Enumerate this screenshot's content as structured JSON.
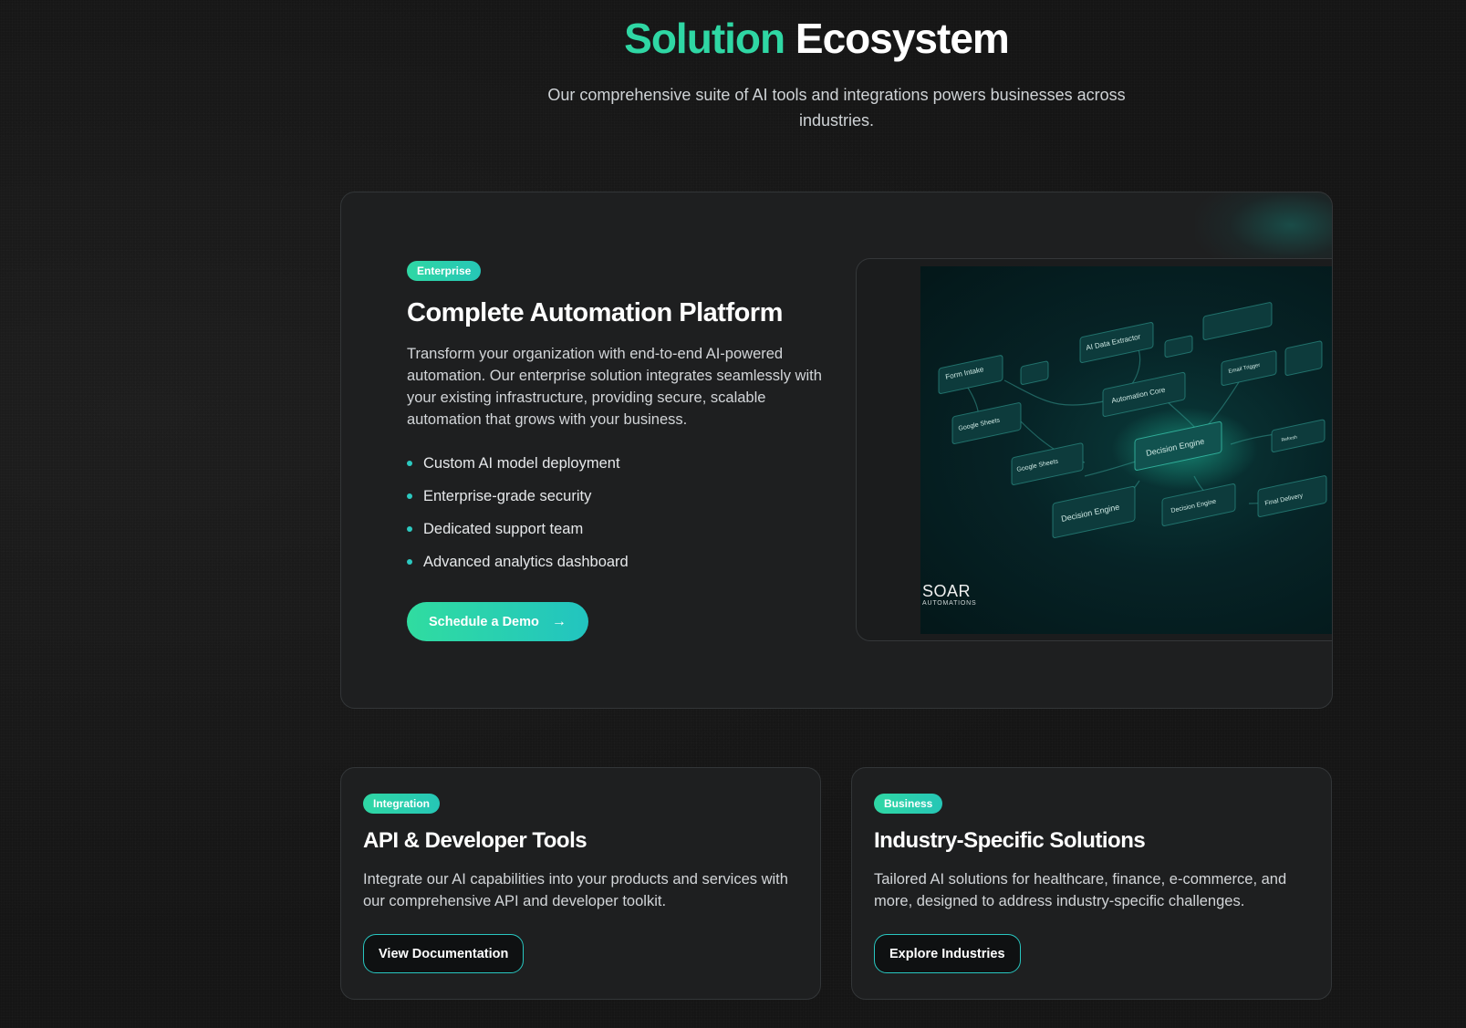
{
  "header": {
    "title_accent": "Solution",
    "title_rest": "Ecosystem",
    "subtitle": "Our comprehensive suite of AI tools and integrations powers businesses across industries."
  },
  "enterprise": {
    "badge": "Enterprise",
    "title": "Complete Automation Platform",
    "description": "Transform your organization with end-to-end AI-powered automation. Our enterprise solution integrates seamlessly with your existing infrastructure, providing secure, scalable automation that grows with your business.",
    "features": [
      "Custom AI model deployment",
      "Enterprise-grade security",
      "Dedicated support team",
      "Advanced analytics dashboard"
    ],
    "cta_label": "Schedule a Demo",
    "cta_icon": "arrow-right-icon",
    "preview": {
      "nodes": [
        "AI Data Extractor",
        "Form Intake",
        "Automation Core",
        "Email Trigger",
        "Google Sheets",
        "Decision Engine",
        "Google Sheets",
        "Decision Engine",
        "Decision Engine",
        "Final Delivery",
        "Refresh"
      ],
      "brand_name": "SOAR",
      "brand_sub": "AUTOMATIONS"
    }
  },
  "integration": {
    "badge": "Integration",
    "title": "API & Developer Tools",
    "description": "Integrate our AI capabilities into your products and services with our comprehensive API and developer toolkit.",
    "cta_label": "View Documentation"
  },
  "business": {
    "badge": "Business",
    "title": "Industry-Specific Solutions",
    "description": "Tailored AI solutions for healthcare, finance, e-commerce, and more, designed to address industry-specific challenges.",
    "cta_label": "Explore Industries"
  },
  "colors": {
    "accent": "#2fd7a4",
    "accent_teal": "#22c4c0",
    "background": "#151515",
    "card": "#1e1f20"
  }
}
